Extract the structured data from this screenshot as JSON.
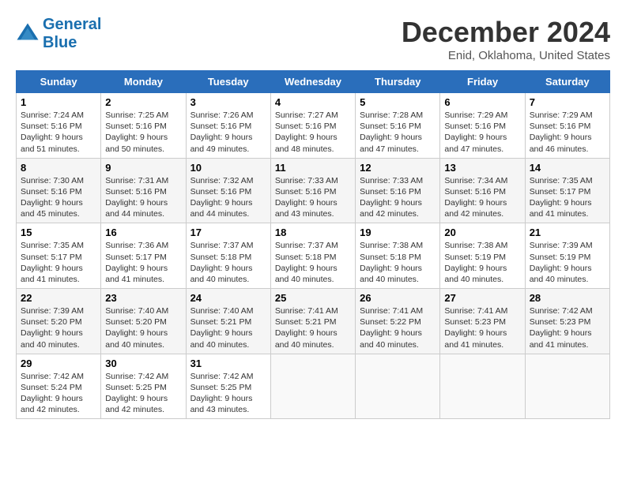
{
  "header": {
    "logo_line1": "General",
    "logo_line2": "Blue",
    "month": "December 2024",
    "location": "Enid, Oklahoma, United States"
  },
  "weekdays": [
    "Sunday",
    "Monday",
    "Tuesday",
    "Wednesday",
    "Thursday",
    "Friday",
    "Saturday"
  ],
  "weeks": [
    [
      {
        "day": "1",
        "sunrise": "Sunrise: 7:24 AM",
        "sunset": "Sunset: 5:16 PM",
        "daylight": "Daylight: 9 hours and 51 minutes."
      },
      {
        "day": "2",
        "sunrise": "Sunrise: 7:25 AM",
        "sunset": "Sunset: 5:16 PM",
        "daylight": "Daylight: 9 hours and 50 minutes."
      },
      {
        "day": "3",
        "sunrise": "Sunrise: 7:26 AM",
        "sunset": "Sunset: 5:16 PM",
        "daylight": "Daylight: 9 hours and 49 minutes."
      },
      {
        "day": "4",
        "sunrise": "Sunrise: 7:27 AM",
        "sunset": "Sunset: 5:16 PM",
        "daylight": "Daylight: 9 hours and 48 minutes."
      },
      {
        "day": "5",
        "sunrise": "Sunrise: 7:28 AM",
        "sunset": "Sunset: 5:16 PM",
        "daylight": "Daylight: 9 hours and 47 minutes."
      },
      {
        "day": "6",
        "sunrise": "Sunrise: 7:29 AM",
        "sunset": "Sunset: 5:16 PM",
        "daylight": "Daylight: 9 hours and 47 minutes."
      },
      {
        "day": "7",
        "sunrise": "Sunrise: 7:29 AM",
        "sunset": "Sunset: 5:16 PM",
        "daylight": "Daylight: 9 hours and 46 minutes."
      }
    ],
    [
      {
        "day": "8",
        "sunrise": "Sunrise: 7:30 AM",
        "sunset": "Sunset: 5:16 PM",
        "daylight": "Daylight: 9 hours and 45 minutes."
      },
      {
        "day": "9",
        "sunrise": "Sunrise: 7:31 AM",
        "sunset": "Sunset: 5:16 PM",
        "daylight": "Daylight: 9 hours and 44 minutes."
      },
      {
        "day": "10",
        "sunrise": "Sunrise: 7:32 AM",
        "sunset": "Sunset: 5:16 PM",
        "daylight": "Daylight: 9 hours and 44 minutes."
      },
      {
        "day": "11",
        "sunrise": "Sunrise: 7:33 AM",
        "sunset": "Sunset: 5:16 PM",
        "daylight": "Daylight: 9 hours and 43 minutes."
      },
      {
        "day": "12",
        "sunrise": "Sunrise: 7:33 AM",
        "sunset": "Sunset: 5:16 PM",
        "daylight": "Daylight: 9 hours and 42 minutes."
      },
      {
        "day": "13",
        "sunrise": "Sunrise: 7:34 AM",
        "sunset": "Sunset: 5:16 PM",
        "daylight": "Daylight: 9 hours and 42 minutes."
      },
      {
        "day": "14",
        "sunrise": "Sunrise: 7:35 AM",
        "sunset": "Sunset: 5:17 PM",
        "daylight": "Daylight: 9 hours and 41 minutes."
      }
    ],
    [
      {
        "day": "15",
        "sunrise": "Sunrise: 7:35 AM",
        "sunset": "Sunset: 5:17 PM",
        "daylight": "Daylight: 9 hours and 41 minutes."
      },
      {
        "day": "16",
        "sunrise": "Sunrise: 7:36 AM",
        "sunset": "Sunset: 5:17 PM",
        "daylight": "Daylight: 9 hours and 41 minutes."
      },
      {
        "day": "17",
        "sunrise": "Sunrise: 7:37 AM",
        "sunset": "Sunset: 5:18 PM",
        "daylight": "Daylight: 9 hours and 40 minutes."
      },
      {
        "day": "18",
        "sunrise": "Sunrise: 7:37 AM",
        "sunset": "Sunset: 5:18 PM",
        "daylight": "Daylight: 9 hours and 40 minutes."
      },
      {
        "day": "19",
        "sunrise": "Sunrise: 7:38 AM",
        "sunset": "Sunset: 5:18 PM",
        "daylight": "Daylight: 9 hours and 40 minutes."
      },
      {
        "day": "20",
        "sunrise": "Sunrise: 7:38 AM",
        "sunset": "Sunset: 5:19 PM",
        "daylight": "Daylight: 9 hours and 40 minutes."
      },
      {
        "day": "21",
        "sunrise": "Sunrise: 7:39 AM",
        "sunset": "Sunset: 5:19 PM",
        "daylight": "Daylight: 9 hours and 40 minutes."
      }
    ],
    [
      {
        "day": "22",
        "sunrise": "Sunrise: 7:39 AM",
        "sunset": "Sunset: 5:20 PM",
        "daylight": "Daylight: 9 hours and 40 minutes."
      },
      {
        "day": "23",
        "sunrise": "Sunrise: 7:40 AM",
        "sunset": "Sunset: 5:20 PM",
        "daylight": "Daylight: 9 hours and 40 minutes."
      },
      {
        "day": "24",
        "sunrise": "Sunrise: 7:40 AM",
        "sunset": "Sunset: 5:21 PM",
        "daylight": "Daylight: 9 hours and 40 minutes."
      },
      {
        "day": "25",
        "sunrise": "Sunrise: 7:41 AM",
        "sunset": "Sunset: 5:21 PM",
        "daylight": "Daylight: 9 hours and 40 minutes."
      },
      {
        "day": "26",
        "sunrise": "Sunrise: 7:41 AM",
        "sunset": "Sunset: 5:22 PM",
        "daylight": "Daylight: 9 hours and 40 minutes."
      },
      {
        "day": "27",
        "sunrise": "Sunrise: 7:41 AM",
        "sunset": "Sunset: 5:23 PM",
        "daylight": "Daylight: 9 hours and 41 minutes."
      },
      {
        "day": "28",
        "sunrise": "Sunrise: 7:42 AM",
        "sunset": "Sunset: 5:23 PM",
        "daylight": "Daylight: 9 hours and 41 minutes."
      }
    ],
    [
      {
        "day": "29",
        "sunrise": "Sunrise: 7:42 AM",
        "sunset": "Sunset: 5:24 PM",
        "daylight": "Daylight: 9 hours and 42 minutes."
      },
      {
        "day": "30",
        "sunrise": "Sunrise: 7:42 AM",
        "sunset": "Sunset: 5:25 PM",
        "daylight": "Daylight: 9 hours and 42 minutes."
      },
      {
        "day": "31",
        "sunrise": "Sunrise: 7:42 AM",
        "sunset": "Sunset: 5:25 PM",
        "daylight": "Daylight: 9 hours and 43 minutes."
      },
      null,
      null,
      null,
      null
    ]
  ]
}
